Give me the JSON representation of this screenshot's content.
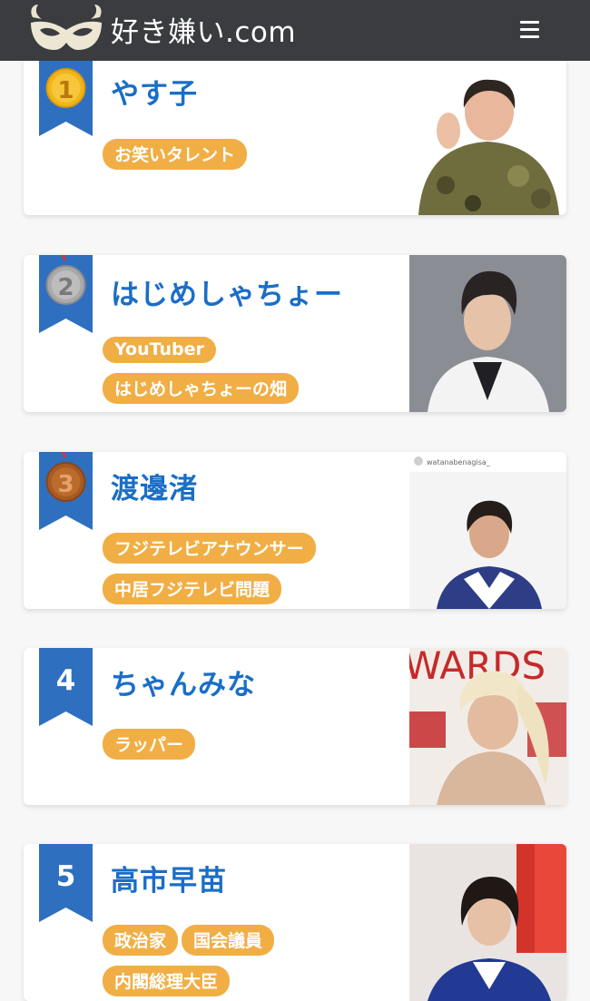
{
  "header": {
    "site_name": "好き嫌い.com",
    "menu_icon": "hamburger-menu-icon"
  },
  "ranking": [
    {
      "rank": "1",
      "name": "やす子",
      "tags": [
        "お笑いタレント"
      ],
      "medal": "gold"
    },
    {
      "rank": "2",
      "name": "はじめしゃちょー",
      "tags": [
        "YouTuber",
        "はじめしゃちょーの畑"
      ],
      "medal": "silver"
    },
    {
      "rank": "3",
      "name": "渡邊渚",
      "tags": [
        "フジテレビアナウンサー",
        "中居フジテレビ問題"
      ],
      "medal": "bronze",
      "photo_caption": "watanabenagisa_"
    },
    {
      "rank": "4",
      "name": "ちゃんみな",
      "tags": [
        "ラッパー"
      ],
      "photo_caption": "WARDS"
    },
    {
      "rank": "5",
      "name": "高市早苗",
      "tags": [
        "政治家",
        "国会議員",
        "内閣総理大臣"
      ]
    }
  ],
  "colors": {
    "header_bg": "#3a3c3f",
    "ribbon": "#2f6fc0",
    "name_text": "#1a6ec7",
    "tag_bg": "#f0ae45",
    "gold": "#f2b517",
    "silver": "#a9a9a9",
    "bronze": "#a85a22"
  }
}
